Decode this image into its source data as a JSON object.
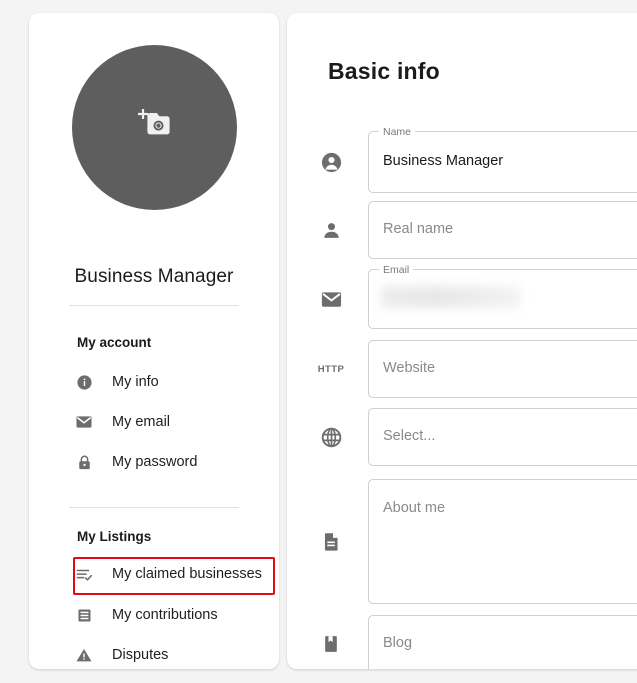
{
  "theme": {
    "page_background": "#f4f4f4",
    "card_background": "#ffffff",
    "avatar_background": "#5e5e5e",
    "icon_color": "#6d6d6d",
    "text_color": "#1b1b1b",
    "placeholder_color": "#8a8a8a",
    "highlight_color": "#e50914",
    "border_color": "#cfcfcf"
  },
  "profile": {
    "avatar_action_icon": "add-photo-camera-icon",
    "name": "Business Manager"
  },
  "sidebar": {
    "sections": [
      {
        "title": "My account",
        "items": [
          {
            "label": "My info",
            "icon": "info-circle-icon",
            "highlighted": false
          },
          {
            "label": "My email",
            "icon": "envelope-icon",
            "highlighted": false
          },
          {
            "label": "My password",
            "icon": "lock-icon",
            "highlighted": false
          }
        ]
      },
      {
        "title": "My Listings",
        "items": [
          {
            "label": "My claimed businesses",
            "icon": "playlist-check-icon",
            "highlighted": true
          },
          {
            "label": "My contributions",
            "icon": "article-list-icon",
            "highlighted": false
          },
          {
            "label": "Disputes",
            "icon": "warning-triangle-icon",
            "highlighted": false
          }
        ]
      }
    ]
  },
  "main": {
    "title": "Basic info",
    "fields": [
      {
        "key": "name",
        "icon": "account-circle-icon",
        "floating_label": "Name",
        "value": "Business Manager",
        "placeholder": "",
        "type": "text"
      },
      {
        "key": "real_name",
        "icon": "person-icon",
        "floating_label": "",
        "value": "",
        "placeholder": "Real name",
        "type": "text"
      },
      {
        "key": "email",
        "icon": "envelope-icon",
        "floating_label": "Email",
        "value": "",
        "value_redacted": true,
        "placeholder": "",
        "type": "email"
      },
      {
        "key": "website",
        "icon": "http-icon",
        "floating_label": "",
        "value": "",
        "placeholder": "Website",
        "type": "url"
      },
      {
        "key": "country",
        "icon": "globe-icon",
        "floating_label": "",
        "value": "",
        "placeholder": "Select...",
        "type": "select"
      },
      {
        "key": "about_me",
        "icon": "document-text-icon",
        "floating_label": "",
        "value": "",
        "placeholder": "About me",
        "type": "textarea"
      },
      {
        "key": "blog",
        "icon": "bookmark-icon",
        "floating_label": "",
        "value": "",
        "placeholder": "Blog",
        "type": "url"
      }
    ]
  }
}
